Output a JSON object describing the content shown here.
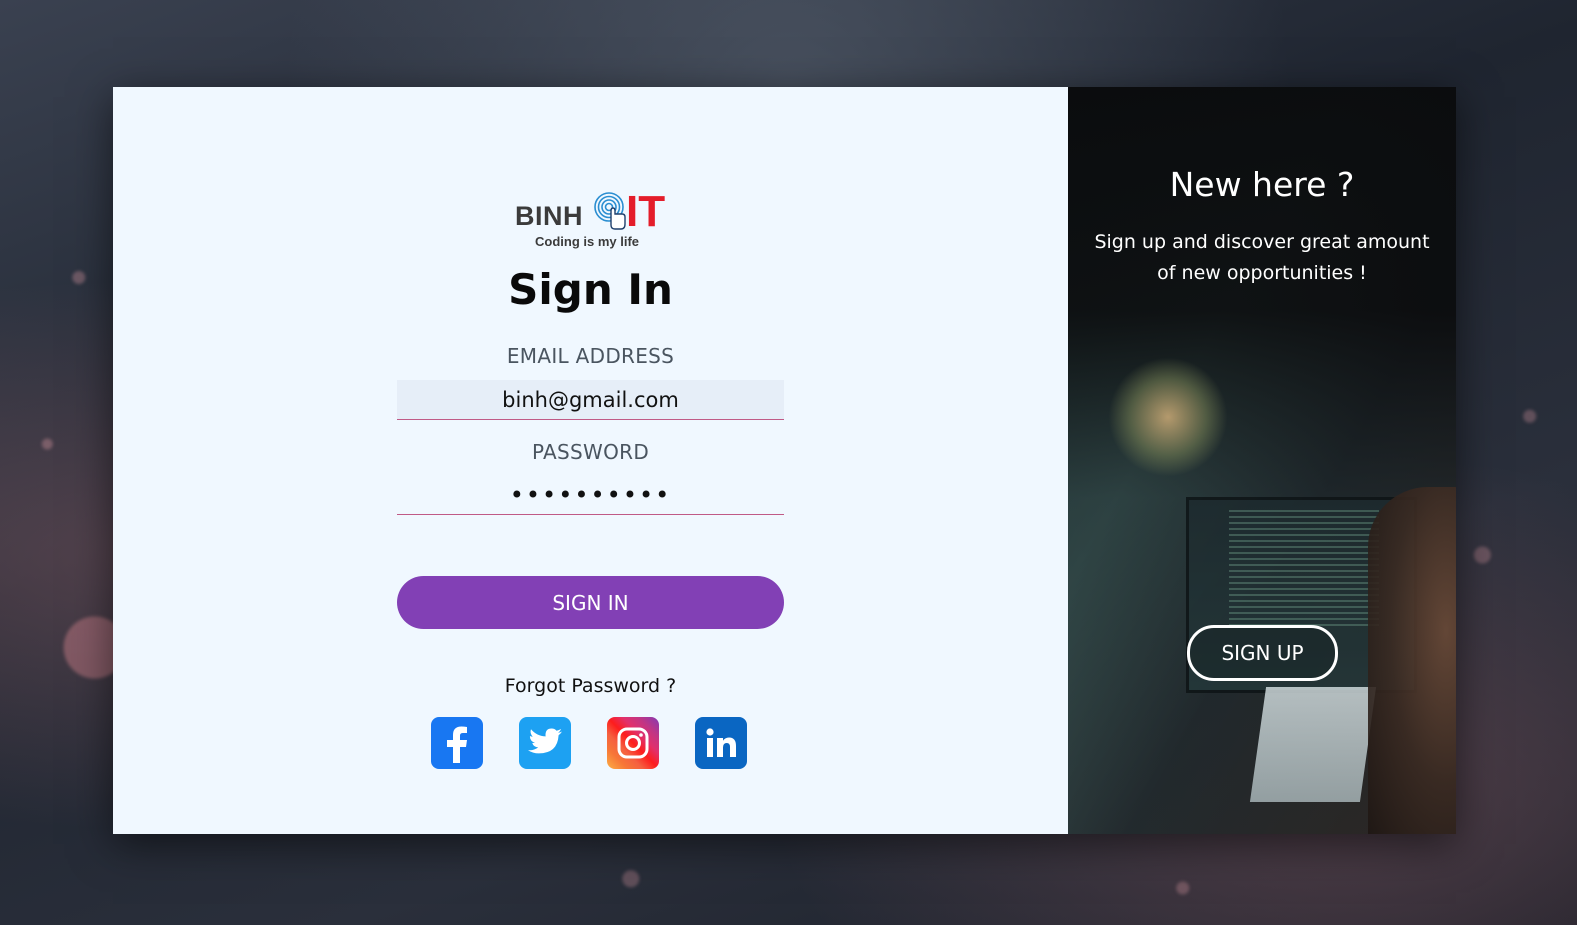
{
  "logo": {
    "brand": "BINH",
    "brand_accent": "IT",
    "tagline": "Coding is my life"
  },
  "signin": {
    "title": "Sign In",
    "email_label": "EMAIL ADDRESS",
    "email_value": "binh@gmail.com",
    "password_label": "PASSWORD",
    "password_value": "••••••••••",
    "button_label": "SIGN IN",
    "forgot_label": "Forgot Password ?"
  },
  "socials": [
    {
      "name": "facebook-icon",
      "color": "#1877f2"
    },
    {
      "name": "twitter-icon",
      "color": "#1da1f2"
    },
    {
      "name": "instagram-icon",
      "color": "#e1306c"
    },
    {
      "name": "linkedin-icon",
      "color": "#0a66c2"
    }
  ],
  "signup_panel": {
    "heading": "New here ?",
    "subtext": "Sign up and discover great amount of new opportunities !",
    "button_label": "SIGN UP"
  },
  "colors": {
    "accent": "#8240b5",
    "input_underline": "#c05a86",
    "panel_bg": "#f0f8ff",
    "logo_red": "#e41d2a"
  }
}
